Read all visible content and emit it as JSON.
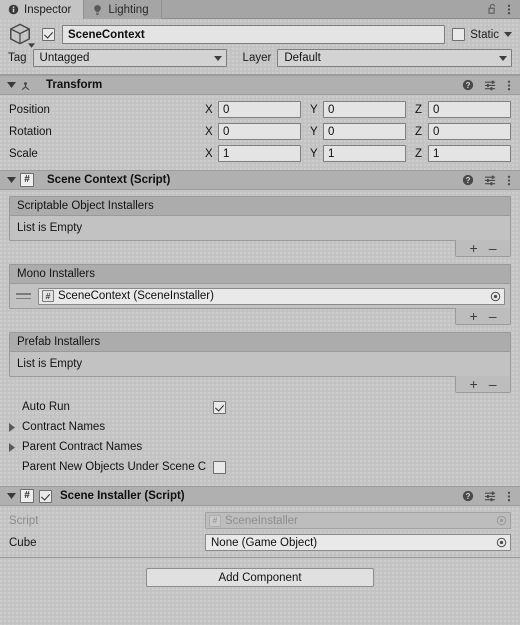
{
  "window": {
    "tabs": [
      {
        "label": "Inspector",
        "icon": "info-icon",
        "active": true
      },
      {
        "label": "Lighting",
        "icon": "lightbulb-icon",
        "active": false
      }
    ],
    "lock_icon": "lock-open-icon",
    "menu_icon": "kebab-menu-icon"
  },
  "gameobject": {
    "icon": "cube-icon",
    "enabled": true,
    "name": "SceneContext",
    "static_label": "Static",
    "static_checked": false,
    "tag_label": "Tag",
    "tag_value": "Untagged",
    "layer_label": "Layer",
    "layer_value": "Default"
  },
  "transform": {
    "title": "Transform",
    "icon": "transform-icon",
    "expanded": true,
    "tools": {
      "help": "help-icon",
      "preset": "preset-icon",
      "menu": "kebab-menu-icon"
    },
    "rows": [
      {
        "label": "Position",
        "x": "0",
        "y": "0",
        "z": "0"
      },
      {
        "label": "Rotation",
        "x": "0",
        "y": "0",
        "z": "0"
      },
      {
        "label": "Scale",
        "x": "1",
        "y": "1",
        "z": "1"
      }
    ],
    "axes": [
      "X",
      "Y",
      "Z"
    ]
  },
  "scene_context": {
    "title": "Scene Context (Script)",
    "badge": "#",
    "expanded": true,
    "lists": [
      {
        "header": "Scriptable Object Installers",
        "empty_text": "List is Empty",
        "items": [],
        "add_label": "+",
        "remove_label": "–"
      },
      {
        "header": "Mono Installers",
        "empty_text": "",
        "items": [
          {
            "badge": "#",
            "value": "SceneContext (SceneInstaller)",
            "picker": "object-picker-icon"
          }
        ],
        "add_label": "+",
        "remove_label": "–"
      },
      {
        "header": "Prefab Installers",
        "empty_text": "List is Empty",
        "items": [],
        "add_label": "+",
        "remove_label": "–"
      }
    ],
    "auto_run": {
      "label": "Auto Run",
      "checked": true
    },
    "foldouts": [
      {
        "label": "Contract Names",
        "expanded": false
      },
      {
        "label": "Parent Contract Names",
        "expanded": false
      }
    ],
    "parent_new_objects": {
      "label": "Parent New Objects Under Scene C",
      "checked": false
    }
  },
  "scene_installer": {
    "title": "Scene Installer (Script)",
    "badge": "#",
    "enabled": true,
    "expanded": true,
    "rows": [
      {
        "label": "Script",
        "badge": "#",
        "value": "SceneInstaller",
        "disabled": true,
        "picker": "object-picker-icon"
      },
      {
        "label": "Cube",
        "badge": "",
        "value": "None (Game Object)",
        "disabled": false,
        "picker": "object-picker-icon"
      }
    ]
  },
  "footer": {
    "add_component_label": "Add Component"
  },
  "colors": {
    "background": "#c4c4c4",
    "header_bar": "#b0b0b0",
    "tab_active": "#c4c4c4",
    "tab_inactive": "#a5a5a5",
    "field": "#e4e4e4",
    "list_header": "#acacac",
    "text": "#141414",
    "disabled_text": "#8d8d8d"
  }
}
